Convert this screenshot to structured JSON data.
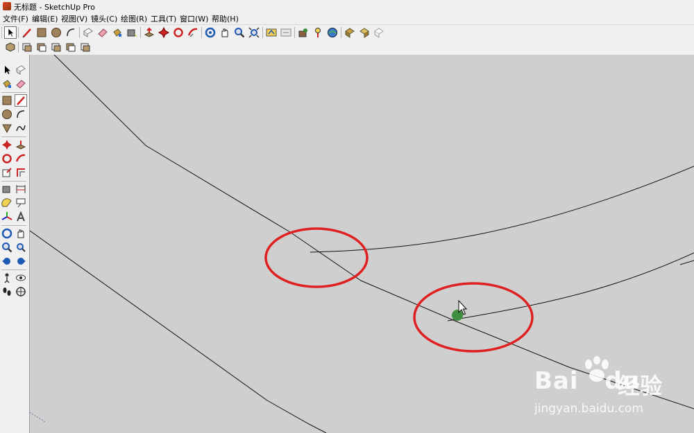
{
  "window": {
    "title": "无标题 - SketchUp Pro"
  },
  "menus": [
    "文件(F)",
    "编辑(E)",
    "视图(V)",
    "镜头(C)",
    "绘图(R)",
    "工具(T)",
    "窗口(W)",
    "帮助(H)"
  ],
  "toolbar_main": [
    "select-icon",
    "pencil-icon",
    "rectangle-icon",
    "circle-icon",
    "arc-icon",
    "make-component-icon",
    "eraser-icon",
    "paint-bucket-icon",
    "tape-measure-icon",
    "push-pull-icon",
    "move-icon",
    "rotate-icon",
    "follow-me-icon",
    "orbit-icon",
    "pan-icon",
    "zoom-icon",
    "zoom-extents-icon",
    "get-models-icon",
    "share-model-icon",
    "google-earth-icon",
    "place-model-icon",
    "toggle-terrain-icon",
    "get-current-view-icon",
    "photo-textures-icon",
    "components-icon"
  ],
  "toolbar_views": [
    "iso-view-icon",
    "top-view-icon",
    "front-view-icon",
    "right-view-icon",
    "back-view-icon",
    "left-view-icon"
  ],
  "left_tools": [
    "select-icon",
    "make-component-icon",
    "paint-bucket-icon",
    "eraser-icon",
    "rectangle-icon",
    "line-icon",
    "circle-icon",
    "arc-icon",
    "polygon-icon",
    "freehand-icon",
    "move-icon",
    "push-pull-icon",
    "rotate-icon",
    "follow-me-icon",
    "scale-icon",
    "offset-icon",
    "tape-measure-icon",
    "dimension-icon",
    "protractor-icon",
    "text-icon",
    "axes-icon",
    "3d-text-icon",
    "orbit-icon",
    "pan-icon",
    "zoom-icon",
    "zoom-window-icon",
    "previous-view-icon",
    "next-view-icon",
    "position-camera-icon",
    "look-around-icon",
    "walk-icon",
    "section-plane-icon"
  ],
  "watermark": {
    "logo": "Bai",
    "logo2": "du",
    "cn": "经验",
    "url": "jingyan.baidu.com"
  },
  "colors": {
    "canvas": "#cfcfcf",
    "annotation": "#e02020",
    "inference_point": "#3f8f3f",
    "chrome": "#f0f0f0"
  }
}
